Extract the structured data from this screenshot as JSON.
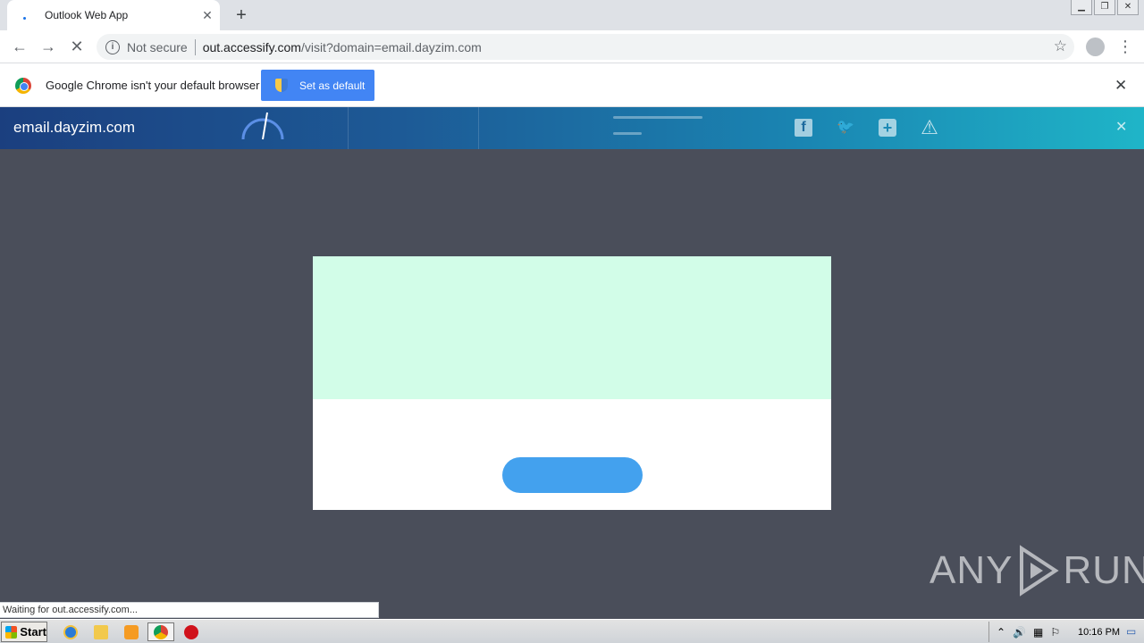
{
  "browser": {
    "tab_title": "Outlook Web App",
    "tab_close": "✕",
    "new_tab": "+",
    "window_controls": [
      "▁",
      "❐",
      "✕"
    ],
    "nav": {
      "back": "←",
      "forward": "→",
      "stop": "✕",
      "info": "i",
      "menu": "⋮",
      "star": "☆"
    },
    "omnibox": {
      "security_label": "Not secure",
      "url_host": "out.accessify.com",
      "url_path": "/visit?domain=email.dayzim.com"
    }
  },
  "infobar": {
    "message": "Google Chrome isn't your default browser",
    "button_label": "Set as default",
    "close": "✕"
  },
  "banner": {
    "domain": "email.dayzim.com",
    "icons": {
      "facebook": "f",
      "twitter": "🐦",
      "add": "+",
      "warning": "⚠",
      "close": "✕"
    }
  },
  "watermark": {
    "left": "ANY",
    "right": "RUN"
  },
  "status_text": "Waiting for out.accessify.com...",
  "taskbar": {
    "start_label": "Start",
    "clock": "10:16 PM",
    "tray_icons": [
      "⌃",
      "🔊",
      "▦",
      "⚐",
      "▭"
    ]
  },
  "colors": {
    "page_background": "#4a4e5a",
    "modal_top": "#d2fde8",
    "modal_button": "#43a1ee",
    "infobar_button": "#4285f4"
  }
}
